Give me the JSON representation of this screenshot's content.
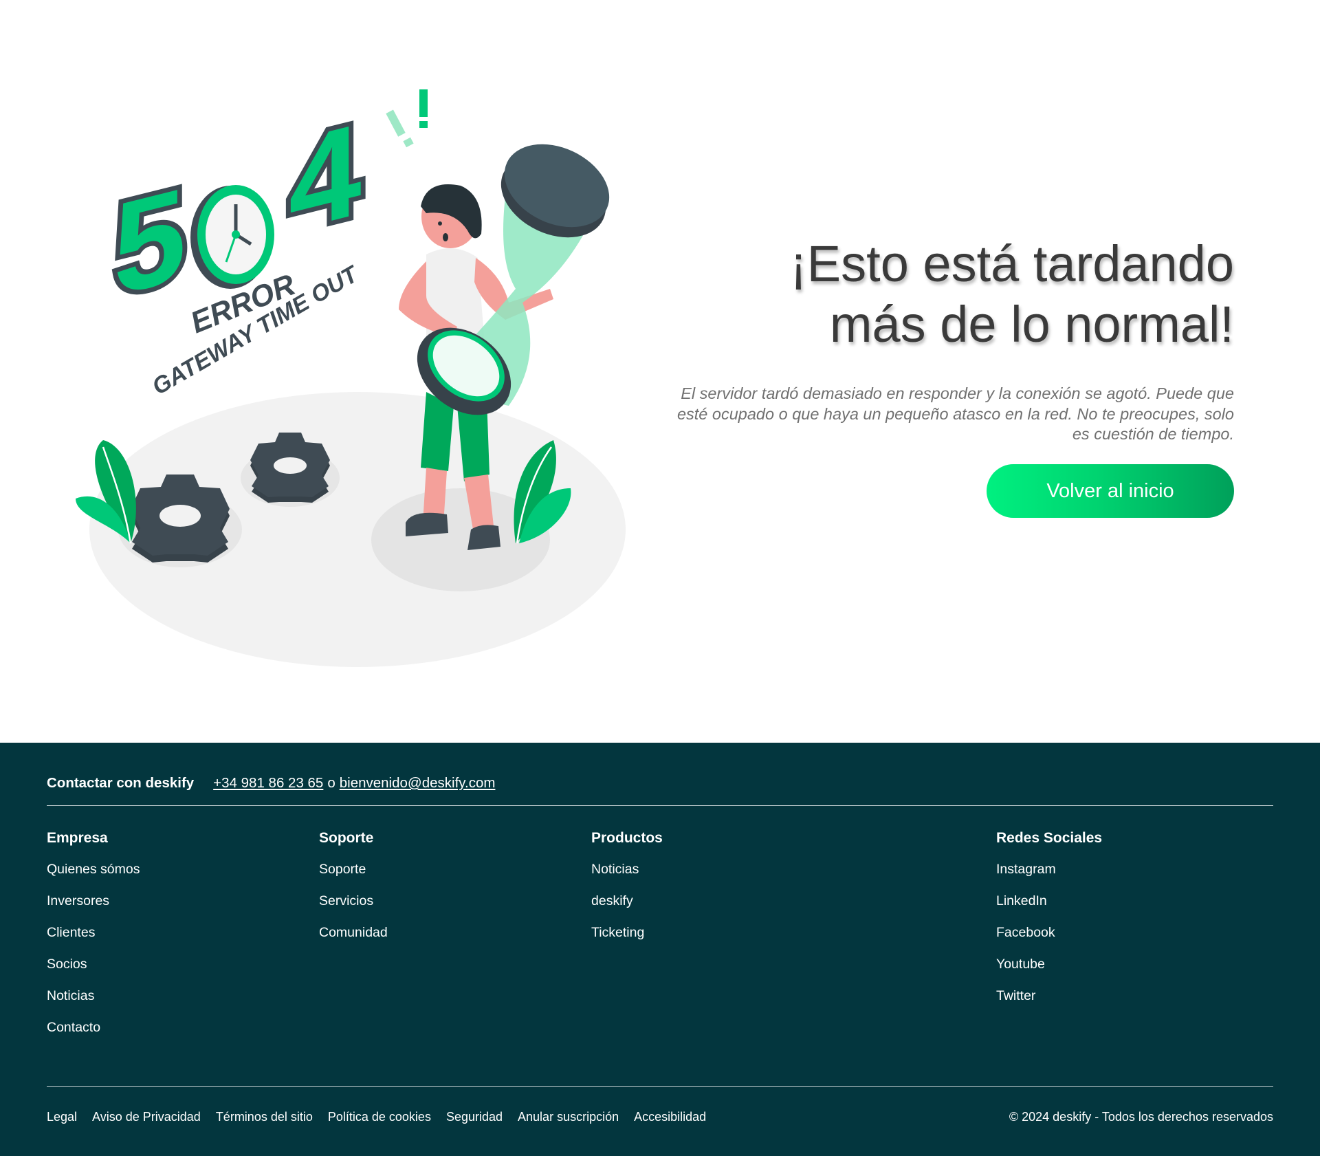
{
  "hero": {
    "illustration_text": {
      "digit_5": "5",
      "digit_4": "4",
      "error_label": "ERROR",
      "gateway_label": "GATEWAY TIME OUT",
      "exclamation": "!"
    },
    "headline_line1": "¡Esto está tardando",
    "headline_line2": "más de lo normal!",
    "subtext": "El servidor tardó demasiado en responder y la conexión se agotó. Puede que esté ocupado o que haya un pequeño atasco en la red. No te preocupes, solo es cuestión de tiempo.",
    "cta_label": "Volver al inicio"
  },
  "footer": {
    "contact": {
      "title": "Contactar con deskify",
      "phone": "+34 981 86 23 65",
      "separator": "o",
      "email": "bienvenido@deskify.com"
    },
    "columns": [
      {
        "title": "Empresa",
        "items": [
          "Quienes sómos",
          "Inversores",
          "Clientes",
          "Socios",
          "Noticias",
          "Contacto"
        ]
      },
      {
        "title": "Soporte",
        "items": [
          "Soporte",
          "Servicios",
          "Comunidad"
        ]
      },
      {
        "title": "Productos",
        "items": [
          "Noticias",
          "deskify",
          "Ticketing"
        ]
      },
      {
        "title": "Redes Sociales",
        "items": [
          "Instagram",
          "LinkedIn",
          "Facebook",
          "Youtube",
          "Twitter"
        ]
      }
    ],
    "legal_links": [
      "Legal",
      "Aviso de Privacidad",
      "Términos del sitio",
      "Política de cookies",
      "Seguridad",
      "Anular suscripción",
      "Accesibilidad"
    ],
    "copyright": "© 2024 deskify - Todos los derechos reservados"
  },
  "colors": {
    "brand_green": "#00c878",
    "footer_bg": "#03363e",
    "dark_slate": "#3f4b54"
  },
  "icons": [
    "clock-icon",
    "gear-icon",
    "hourglass-icon",
    "exclamation-icon",
    "leaf-icon"
  ]
}
